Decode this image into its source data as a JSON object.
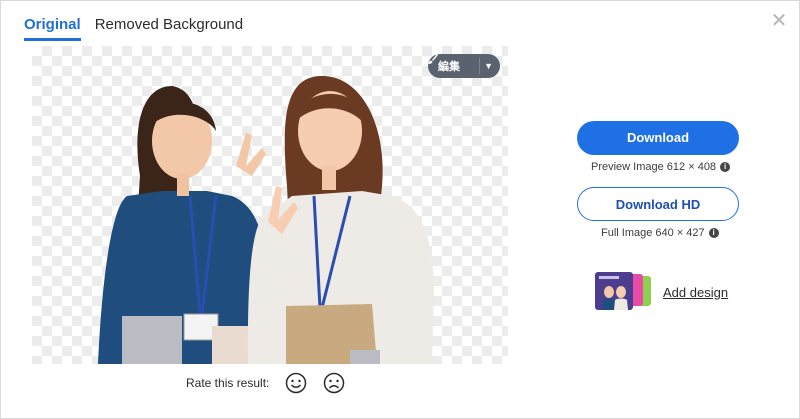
{
  "tabs": [
    {
      "label": "Original",
      "active": true
    },
    {
      "label": "Removed Background",
      "active": false
    }
  ],
  "close": {
    "glyph": "✕",
    "icon": "close-icon"
  },
  "preview": {
    "edit_label": "編集",
    "edit_icon": "brush-icon",
    "caret_icon": "caret-down-icon"
  },
  "rating": {
    "label": "Rate this result:",
    "happy_icon": "smile-face-icon",
    "sad_icon": "frown-face-icon"
  },
  "download": {
    "label": "Download",
    "preview_text": "Preview Image 612 × 408"
  },
  "download_hd": {
    "label": "Download HD",
    "full_text": "Full Image 640 × 427"
  },
  "info_glyph": "i",
  "add_design": {
    "label": "Add design"
  },
  "colors": {
    "accent": "#1f6fe5",
    "tab_active": "#1f6fd8",
    "edit_button_bg": "#5a6270"
  }
}
